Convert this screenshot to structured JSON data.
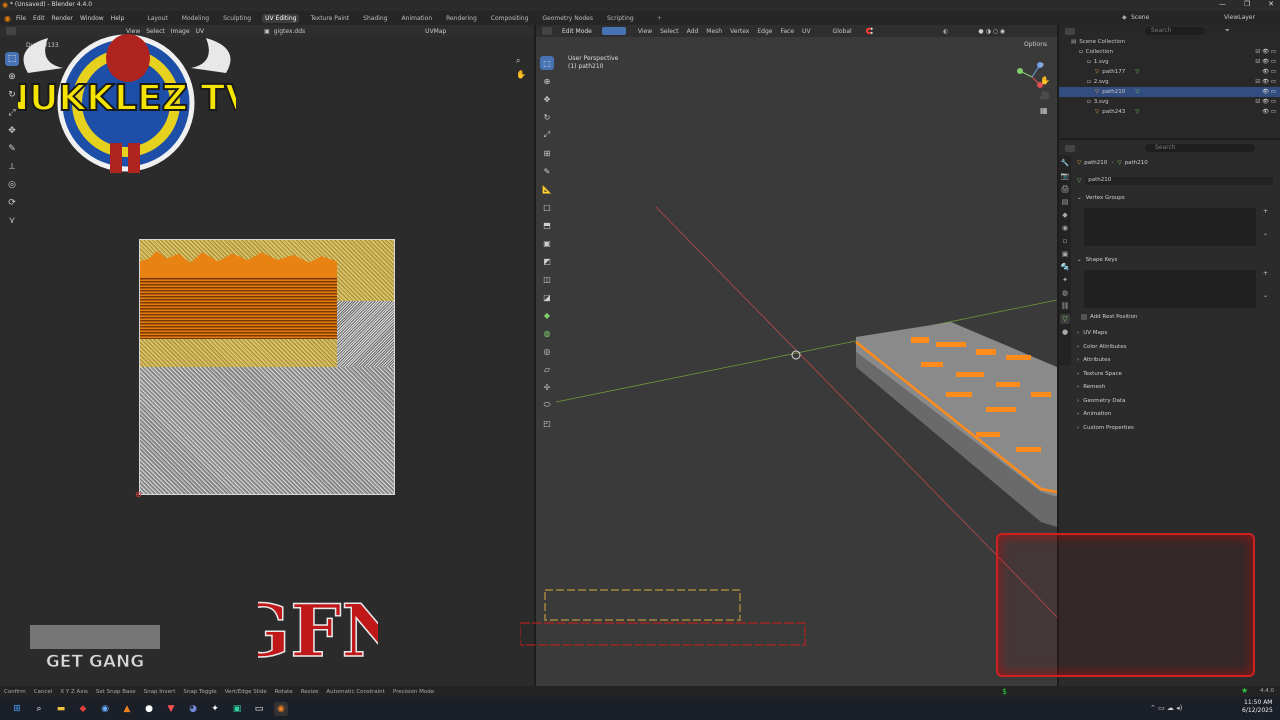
{
  "window": {
    "title": "* (Unsaved) - Blender 4.4.0",
    "controls": [
      "—",
      "❐",
      "✕"
    ]
  },
  "menu": {
    "items": [
      "File",
      "Edit",
      "Render",
      "Window",
      "Help"
    ],
    "workspaces": [
      "Layout",
      "Modeling",
      "Sculpting",
      "UV Editing",
      "Texture Paint",
      "Shading",
      "Animation",
      "Rendering",
      "Compositing",
      "Geometry Nodes",
      "Scripting"
    ],
    "active_workspace": "UV Editing",
    "scene": "Scene",
    "view_layer": "ViewLayer"
  },
  "uv_editor": {
    "header_items": [
      "View",
      "Select",
      "Image",
      "UV"
    ],
    "image_name": "gigtex.dds",
    "uv_map": "UVMap",
    "readout": "Dy: 0.0133"
  },
  "viewport": {
    "mode": "Edit Mode",
    "menus": [
      "View",
      "Select",
      "Add",
      "Mesh",
      "Vertex",
      "Edge",
      "Face",
      "UV"
    ],
    "transform_orientation": "Global",
    "overlay_title": "User Perspective",
    "overlay_object": "(1) path210",
    "options_label": "Options"
  },
  "outliner": {
    "search_placeholder": "Search",
    "rows": [
      {
        "label": "Scene Collection",
        "indent": 0
      },
      {
        "label": "Collection",
        "indent": 1
      },
      {
        "label": "1.svg",
        "indent": 2
      },
      {
        "label": "path177",
        "indent": 3
      },
      {
        "label": "2.svg",
        "indent": 2
      },
      {
        "label": "path210",
        "indent": 3,
        "selected": true
      },
      {
        "label": "3.svg",
        "indent": 2
      },
      {
        "label": "path243",
        "indent": 3
      }
    ]
  },
  "properties": {
    "search_placeholder": "Search",
    "breadcrumb_object": "path210",
    "breadcrumb_data": "path210",
    "data_name": "path210",
    "panels": {
      "vertex_groups": "Vertex Groups",
      "shape_keys": "Shape Keys",
      "add_rest_position": "Add Rest Position",
      "uv_maps": "UV Maps",
      "color_attributes": "Color Attributes",
      "attributes": "Attributes",
      "texture_space": "Texture Space",
      "remesh": "Remesh",
      "geometry_data": "Geometry Data",
      "animation": "Animation",
      "custom_properties": "Custom Properties"
    }
  },
  "statusbar": {
    "items": [
      "Confirm",
      "Cancel",
      "X Y Z Axis",
      "Set Snap Base",
      "Snap Invert",
      "Snap Toggle",
      "Vert/Edge Slide",
      "Rotate",
      "Resize",
      "Automatic Constraint",
      "Precision Mode"
    ],
    "version": "4.4.0"
  },
  "taskbar": {
    "time": "11:50 AM",
    "date": "6/12/2025"
  },
  "overlays": {
    "logo_main": "NUKKLEZ TV",
    "logo_gfn": "GFN",
    "logo_getgang": "GET GANG"
  },
  "colors": {
    "accent": "#4772b3",
    "selection_orange": "#ff8c1a",
    "axis_red": "#c84848",
    "axis_green": "#7aa33a"
  }
}
